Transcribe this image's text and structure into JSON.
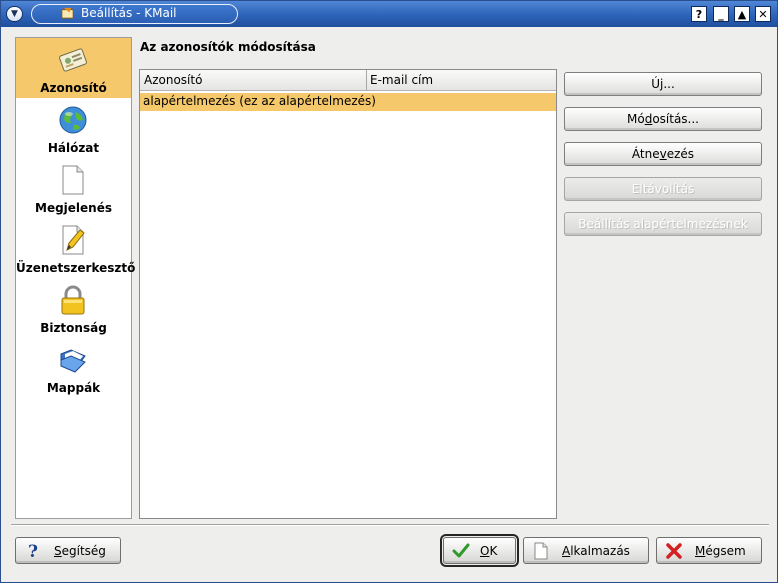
{
  "window": {
    "title": "Beállítás - KMail"
  },
  "titlebar_buttons": [
    {
      "name": "help-icon",
      "glyph": "?"
    },
    {
      "name": "minimize-icon",
      "glyph": "_"
    },
    {
      "name": "maximize-icon",
      "glyph": "▲"
    },
    {
      "name": "close-icon",
      "glyph": "✕"
    }
  ],
  "sidebar": {
    "items": [
      {
        "label": "Azonosító",
        "icon": "identity-card-icon",
        "active": true
      },
      {
        "label": "Hálózat",
        "icon": "globe-icon",
        "active": false
      },
      {
        "label": "Megjelenés",
        "icon": "document-icon",
        "active": false
      },
      {
        "label": "Üzenetszerkesztő",
        "icon": "pencil-icon",
        "active": false
      },
      {
        "label": "Biztonság",
        "icon": "padlock-icon",
        "active": false
      },
      {
        "label": "Mappák",
        "icon": "folder-icon",
        "active": false
      }
    ]
  },
  "main": {
    "title": "Az azonosítók módosítása",
    "columns": [
      "Azonosító",
      "E-mail cím"
    ],
    "rows": [
      {
        "identity": "alapértelmezés (ez az alapértelmezés)",
        "email": ""
      }
    ]
  },
  "actions": {
    "new": {
      "before": "Új",
      "accel": "",
      "after": "...",
      "enabled": true
    },
    "modify": {
      "before": "Mó",
      "accel": "d",
      "after": "osítás...",
      "enabled": true
    },
    "rename": {
      "before": "Átne",
      "accel": "v",
      "after": "ezés",
      "enabled": true
    },
    "remove": {
      "label": "Eltávolítás",
      "enabled": false
    },
    "set_default": {
      "label": "Beállítás alapértelmezésnek",
      "enabled": false
    }
  },
  "footer": {
    "help": {
      "accel": "S",
      "rest": "egítség"
    },
    "ok": {
      "accel": "O",
      "rest": "K"
    },
    "apply": {
      "accel": "A",
      "rest": "lkalmazás"
    },
    "cancel": {
      "accel": "M",
      "rest": "égsem"
    }
  },
  "colors": {
    "selection": "#f6c86c",
    "titlebar": "#2d63b8"
  }
}
